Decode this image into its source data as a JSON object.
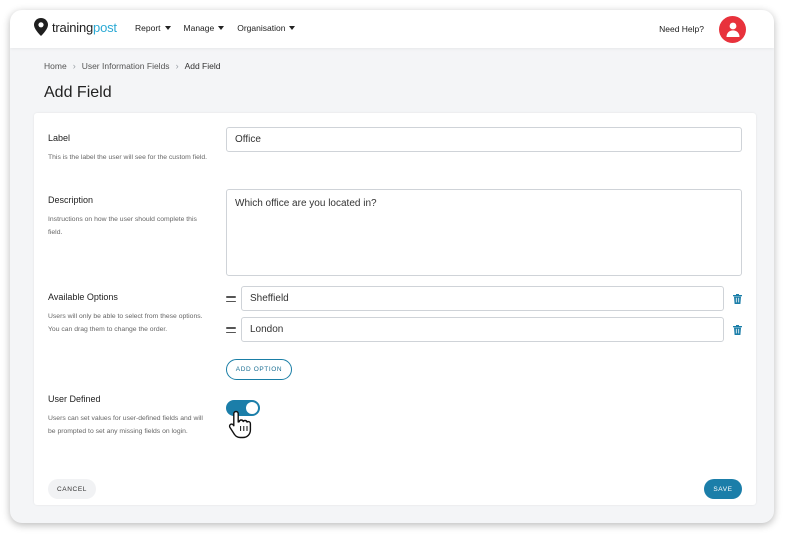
{
  "brand": {
    "word1": "training",
    "word2": "post"
  },
  "nav": {
    "items": [
      {
        "label": "Report"
      },
      {
        "label": "Manage"
      },
      {
        "label": "Organisation"
      }
    ],
    "help_label": "Need Help?"
  },
  "breadcrumb": {
    "home": "Home",
    "parent": "User Information Fields",
    "current": "Add Field"
  },
  "page_title": "Add Field",
  "form": {
    "label": {
      "title": "Label",
      "help": "This is the label the user will see for the custom field.",
      "value": "Office"
    },
    "description": {
      "title": "Description",
      "help": "Instructions on how the user should complete this field.",
      "value": "Which office are you located in?"
    },
    "options": {
      "title": "Available Options",
      "help": "Users will only be able to select from these options. You can drag them to change the order.",
      "items": [
        "Sheffield",
        "London"
      ],
      "add_label": "ADD OPTION"
    },
    "user_defined": {
      "title": "User Defined",
      "help": "Users can set values for user-defined fields and will be prompted to set any missing fields on login.",
      "enabled": true
    },
    "cancel_label": "CANCEL",
    "save_label": "SAVE"
  },
  "colors": {
    "accent": "#1b7ea9",
    "brand": "#2aa9d4",
    "avatar": "#e8323c",
    "background": "#f4f5f7"
  },
  "icons": {
    "logo": "map-pin-icon",
    "avatar": "user-icon",
    "drag": "drag-handle-icon",
    "delete": "trash-icon",
    "pointer": "hand-pointer-icon",
    "breadcrumb_separator": "chevron-right-icon",
    "dropdown": "caret-down-icon"
  }
}
